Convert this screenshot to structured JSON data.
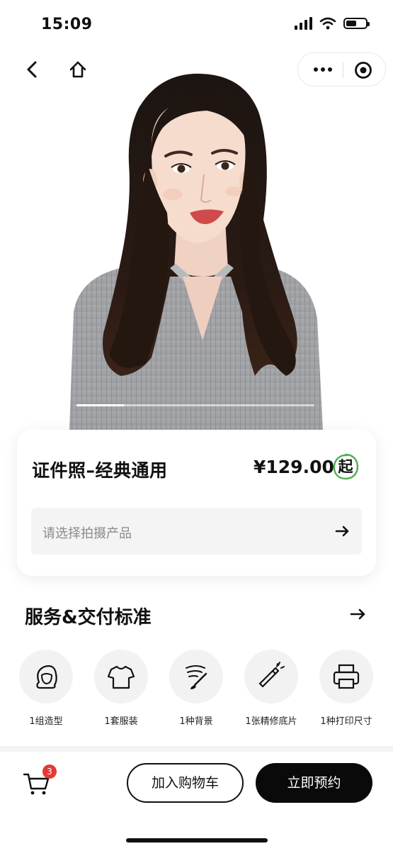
{
  "status_bar": {
    "time": "15:09",
    "battery_level": 0.55
  },
  "navigation": {
    "back_icon": "chevron-left-icon",
    "home_icon": "home-icon",
    "more_icon": "more-dots-icon",
    "close_icon": "target-close-icon"
  },
  "hero": {
    "slide_total": 5,
    "slide_active": 1
  },
  "product": {
    "title": "证件照–经典通用",
    "price": "¥129.00",
    "price_suffix": "起",
    "select_placeholder": "请选择拍摄产品"
  },
  "services": {
    "title": "服务&交付标准",
    "items": [
      {
        "icon": "hair-styling-icon",
        "label": "1组造型"
      },
      {
        "icon": "tshirt-icon",
        "label": "1套服装"
      },
      {
        "icon": "paint-brush-icon",
        "label": "1种背景"
      },
      {
        "icon": "retouch-pen-icon",
        "label": "1张精修底片"
      },
      {
        "icon": "printer-icon",
        "label": "1种打印尺寸"
      }
    ]
  },
  "bottom_bar": {
    "cart_count": "3",
    "add_to_cart": "加入购物车",
    "book_now": "立即预约"
  },
  "colors": {
    "accent_badge_ring": "#4caf50",
    "cart_badge": "#e53935",
    "primary_button": "#0a0a0a"
  }
}
